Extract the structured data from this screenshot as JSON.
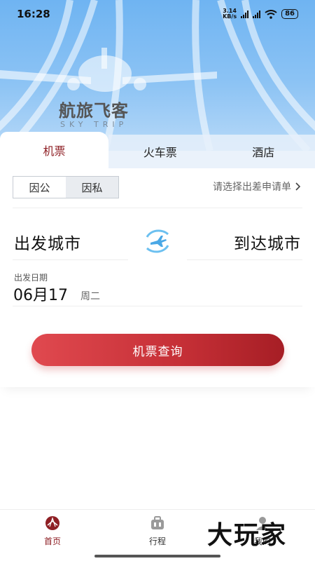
{
  "status_bar": {
    "time": "16:28",
    "net_speed_value": "3.14",
    "net_speed_unit": "KB/s",
    "battery": "86"
  },
  "brand": {
    "name_cn": "航旅飞客",
    "name_en": "SKY TRIP"
  },
  "tabs": [
    {
      "label": "机票",
      "active": true
    },
    {
      "label": "火车票",
      "active": false
    },
    {
      "label": "酒店",
      "active": false
    }
  ],
  "trip_type": {
    "options": [
      "因公",
      "因私"
    ],
    "selected": "因公"
  },
  "apply_link": "请选择出差申请单",
  "from_city": "出发城市",
  "to_city": "到达城市",
  "date": {
    "label": "出发日期",
    "value": "06月17",
    "weekday": "周二"
  },
  "search_button": "机票查询",
  "bottom_nav": [
    {
      "label": "首页",
      "icon": "home-plane-icon",
      "active": true
    },
    {
      "label": "行程",
      "icon": "luggage-icon",
      "active": false
    },
    {
      "label": "我的",
      "icon": "profile-icon",
      "active": false
    }
  ],
  "watermark": "大玩家",
  "colors": {
    "accent": "#8e1f24",
    "button_gradient_start": "#e0494f",
    "button_gradient_end": "#a61e25",
    "hero_blue": "#8cc3f4"
  }
}
